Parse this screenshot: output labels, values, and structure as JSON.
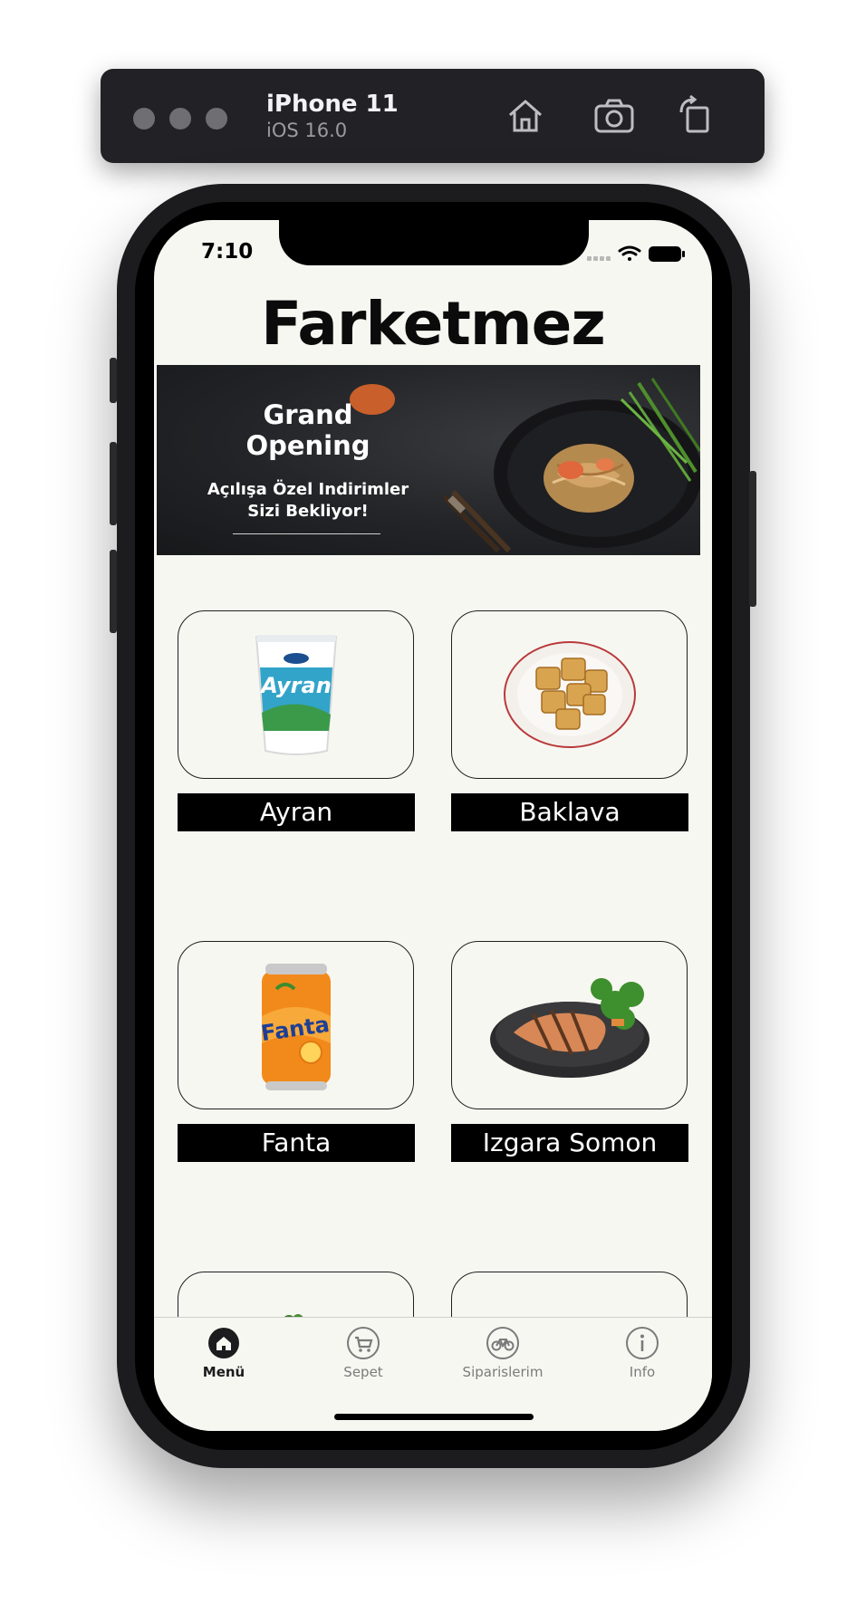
{
  "simulator": {
    "device_name": "iPhone 11",
    "os_version": "iOS 16.0",
    "buttons": [
      {
        "icon": "home-icon"
      },
      {
        "icon": "camera-icon"
      },
      {
        "icon": "rotate-icon"
      }
    ]
  },
  "status_bar": {
    "time": "7:10",
    "icons": [
      "cellular-icon",
      "wifi-icon",
      "battery-icon"
    ]
  },
  "app": {
    "title": "Farketmez"
  },
  "banner": {
    "headline": "Grand Opening",
    "subtitle_line1": "Açılışa Özel Indirimler",
    "subtitle_line2": "Sizi Bekliyor!"
  },
  "menu_items": [
    {
      "name": "Ayran",
      "image": "ayran-cup-image"
    },
    {
      "name": "Baklava",
      "image": "baklava-plate-image"
    },
    {
      "name": "Fanta",
      "image": "fanta-can-image"
    },
    {
      "name": "Izgara Somon",
      "image": "grilled-salmon-image"
    }
  ],
  "tabs": [
    {
      "label": "Menü",
      "icon": "home-icon",
      "active": true
    },
    {
      "label": "Sepet",
      "icon": "cart-icon",
      "active": false
    },
    {
      "label": "Siparislerim",
      "icon": "bicycle-icon",
      "active": false
    },
    {
      "label": "Info",
      "icon": "info-icon",
      "active": false
    }
  ],
  "colors": {
    "background": "#f7f7f2",
    "label_bg": "#000000",
    "tab_active": "#1c1c1e",
    "tab_inactive": "#7a7a7a",
    "banner_accent": "#c95f2a"
  }
}
